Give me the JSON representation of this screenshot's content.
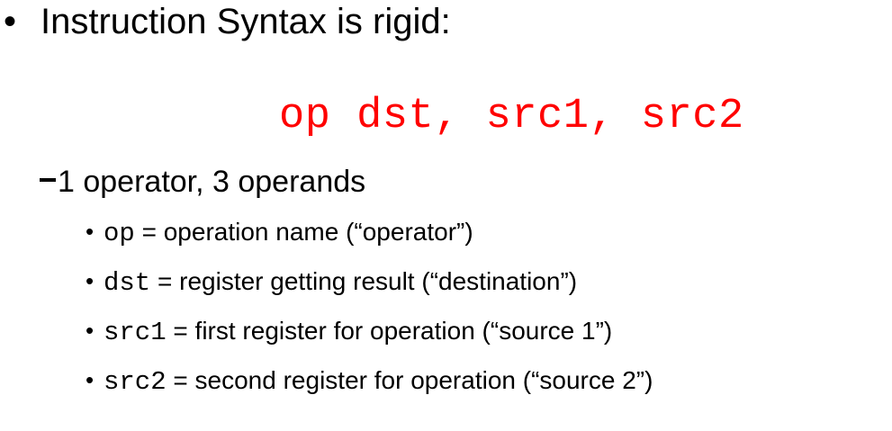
{
  "slide": {
    "heading": "Instruction Syntax is rigid:",
    "syntax": "op dst, src1, src2",
    "syntax_color": "#ff0000",
    "sub_point": "1 operator, 3 operands",
    "bullet_char": "•",
    "items": [
      {
        "code": "op",
        "desc": " = operation name (“operator”)"
      },
      {
        "code": "dst",
        "desc": " = register getting result (“destination”)"
      },
      {
        "code": "src1",
        "desc": " = first register for operation (“source 1”)"
      },
      {
        "code": "src2",
        "desc": " = second register for operation (“source 2”)"
      }
    ]
  }
}
